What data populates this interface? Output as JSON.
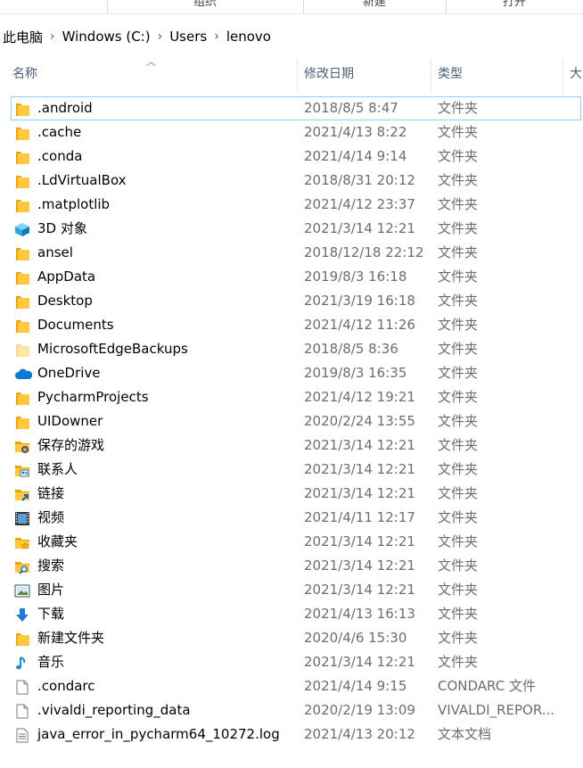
{
  "ribbon": {
    "groups": [
      "组织",
      "新建",
      "打开"
    ]
  },
  "breadcrumb": {
    "items": [
      "此电脑",
      "Windows (C:)",
      "Users",
      "lenovo"
    ]
  },
  "columns": {
    "name": "名称",
    "date": "修改日期",
    "type": "类型",
    "size": "大"
  },
  "files": [
    {
      "name": ".android",
      "date": "2018/8/5 8:47",
      "type": "文件夹",
      "icon": "folder-icon"
    },
    {
      "name": ".cache",
      "date": "2021/4/13 8:22",
      "type": "文件夹",
      "icon": "folder-icon"
    },
    {
      "name": ".conda",
      "date": "2021/4/14 9:14",
      "type": "文件夹",
      "icon": "folder-icon"
    },
    {
      "name": ".LdVirtualBox",
      "date": "2018/8/31 20:12",
      "type": "文件夹",
      "icon": "folder-icon"
    },
    {
      "name": ".matplotlib",
      "date": "2021/4/12 23:37",
      "type": "文件夹",
      "icon": "folder-icon"
    },
    {
      "name": "3D 对象",
      "date": "2021/3/14 12:21",
      "type": "文件夹",
      "icon": "3d-objects-icon"
    },
    {
      "name": "ansel",
      "date": "2018/12/18 22:12",
      "type": "文件夹",
      "icon": "folder-icon"
    },
    {
      "name": "AppData",
      "date": "2019/8/3 16:18",
      "type": "文件夹",
      "icon": "folder-icon"
    },
    {
      "name": "Desktop",
      "date": "2021/3/19 16:18",
      "type": "文件夹",
      "icon": "folder-icon"
    },
    {
      "name": "Documents",
      "date": "2021/4/12 11:26",
      "type": "文件夹",
      "icon": "folder-icon"
    },
    {
      "name": "MicrosoftEdgeBackups",
      "date": "2018/8/5 8:36",
      "type": "文件夹",
      "icon": "hidden-folder-icon"
    },
    {
      "name": "OneDrive",
      "date": "2019/8/3 16:35",
      "type": "文件夹",
      "icon": "onedrive-cloud-icon"
    },
    {
      "name": "PycharmProjects",
      "date": "2021/4/12 19:21",
      "type": "文件夹",
      "icon": "folder-icon"
    },
    {
      "name": "UIDowner",
      "date": "2020/2/24 13:55",
      "type": "文件夹",
      "icon": "folder-icon"
    },
    {
      "name": "保存的游戏",
      "date": "2021/3/14 12:21",
      "type": "文件夹",
      "icon": "saved-games-icon"
    },
    {
      "name": "联系人",
      "date": "2021/3/14 12:21",
      "type": "文件夹",
      "icon": "contacts-icon"
    },
    {
      "name": "链接",
      "date": "2021/3/14 12:21",
      "type": "文件夹",
      "icon": "links-icon"
    },
    {
      "name": "视频",
      "date": "2021/4/11 12:17",
      "type": "文件夹",
      "icon": "videos-icon"
    },
    {
      "name": "收藏夹",
      "date": "2021/3/14 12:21",
      "type": "文件夹",
      "icon": "favorites-icon"
    },
    {
      "name": "搜索",
      "date": "2021/3/14 12:21",
      "type": "文件夹",
      "icon": "searches-icon"
    },
    {
      "name": "图片",
      "date": "2021/3/14 12:21",
      "type": "文件夹",
      "icon": "pictures-icon"
    },
    {
      "name": "下载",
      "date": "2021/4/13 16:13",
      "type": "文件夹",
      "icon": "downloads-icon"
    },
    {
      "name": "新建文件夹",
      "date": "2020/4/6 15:30",
      "type": "文件夹",
      "icon": "folder-icon"
    },
    {
      "name": "音乐",
      "date": "2021/3/14 12:21",
      "type": "文件夹",
      "icon": "music-icon"
    },
    {
      "name": ".condarc",
      "date": "2021/4/14 9:15",
      "type": "CONDARC 文件",
      "icon": "file-icon"
    },
    {
      "name": ".vivaldi_reporting_data",
      "date": "2020/2/19 13:09",
      "type": "VIVALDI_REPOR...",
      "icon": "file-icon"
    },
    {
      "name": "java_error_in_pycharm64_10272.log",
      "date": "2021/4/13 20:12",
      "type": "文本文档",
      "icon": "text-document-icon"
    }
  ],
  "colors": {
    "folder": "#ffc83d",
    "folder_dark": "#e8a317",
    "header_text": "#4c607a",
    "secondary_text": "#6d6d6d",
    "selection_outline": "#99c9ef"
  }
}
